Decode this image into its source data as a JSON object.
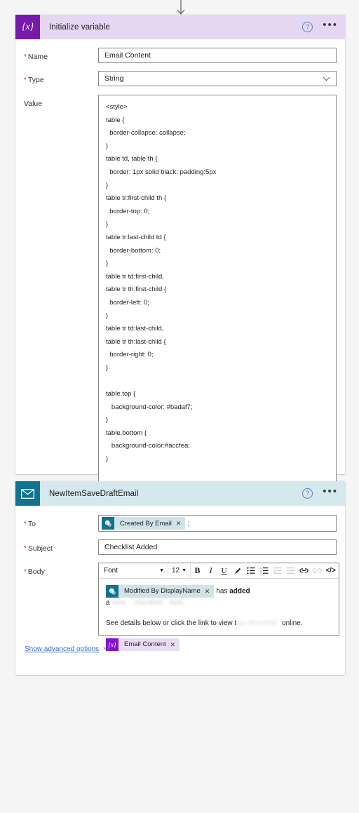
{
  "connector": {
    "icon": "arrow-down-icon"
  },
  "variable_card": {
    "icon": "variable-braces-icon",
    "icon_glyph": "{x}",
    "title": "Initialize variable",
    "help_icon": "help-circle-icon",
    "menu_icon": "more-options-icon",
    "accent_color": "#7719aa",
    "header_color": "#e5d7f2",
    "fields": {
      "name_label": "Name",
      "name_value": "Email Content",
      "type_label": "Type",
      "type_value": "String",
      "type_chevron": "chevron-down-icon",
      "value_label": "Value"
    },
    "value_lines": [
      "<style>",
      "table {",
      "  border-collapse: collapse;",
      "}",
      "table td, table th {",
      "  border: 1px solid black; padding:5px",
      "}",
      "table tr:first-child th {",
      "  border-top: 0;",
      "}",
      "table tr:last-child td {",
      "  border-bottom: 0;",
      "}",
      "table tr td:first-child,",
      "table tr th:first-child {",
      "  border-left: 0;",
      "}",
      "table tr td:last-child,",
      "table tr th:last-child {",
      "  border-right: 0;",
      "}",
      "",
      "table.top {",
      "   background-color: #badaf7;",
      "}",
      "table.bottom {",
      "   background-color:#accfea;",
      "}"
    ]
  },
  "email_card": {
    "icon": "envelope-icon",
    "title": "NewItemSaveDraftEmail",
    "help_icon": "help-circle-icon",
    "menu_icon": "more-options-icon",
    "accent_color": "#0f7391",
    "header_color": "#d4e8ee",
    "to": {
      "label": "To",
      "token_icon": "sharepoint-icon",
      "token_label": "Created By Email",
      "token_remove": "remove-token-icon",
      "trailing_text": ";"
    },
    "subject": {
      "label": "Subject",
      "value": "Checklist Added"
    },
    "body": {
      "label": "Body",
      "toolbar": {
        "font_label": "Font",
        "font_chevron": "chevron-down-icon",
        "size_label": "12",
        "size_chevron": "chevron-down-icon",
        "bold": "bold-icon",
        "italic": "italic-icon",
        "underline": "underline-icon",
        "highlight": "highlight-pen-icon",
        "bullet_list": "bullet-list-icon",
        "numbered_list": "numbered-list-icon",
        "outdent": "outdent-icon",
        "indent": "indent-icon",
        "link": "link-icon",
        "unlink": "unlink-icon",
        "code": "code-view-icon",
        "bold_label": "B",
        "italic_label": "I",
        "underline_label": "U",
        "code_label": "</>"
      },
      "line1": {
        "token_icon": "sharepoint-icon",
        "token_label": "Modified By DisplayName",
        "token_remove": "remove-token-icon",
        "text_prefix": "has ",
        "text_bold": "added",
        "text_suffix": " a",
        "redacted": "redacted-text"
      },
      "line2": {
        "text_prefix": "See details below or click the link to view t",
        "redacted": "redacted-text",
        "text_suffix": "online."
      },
      "variable_token": {
        "icon": "variable-braces-icon",
        "icon_glyph": "{x}",
        "label": "Email Content",
        "remove": "remove-token-icon"
      }
    },
    "advanced_link": {
      "label": "Show advanced options",
      "chevron": "chevron-down-icon"
    }
  }
}
